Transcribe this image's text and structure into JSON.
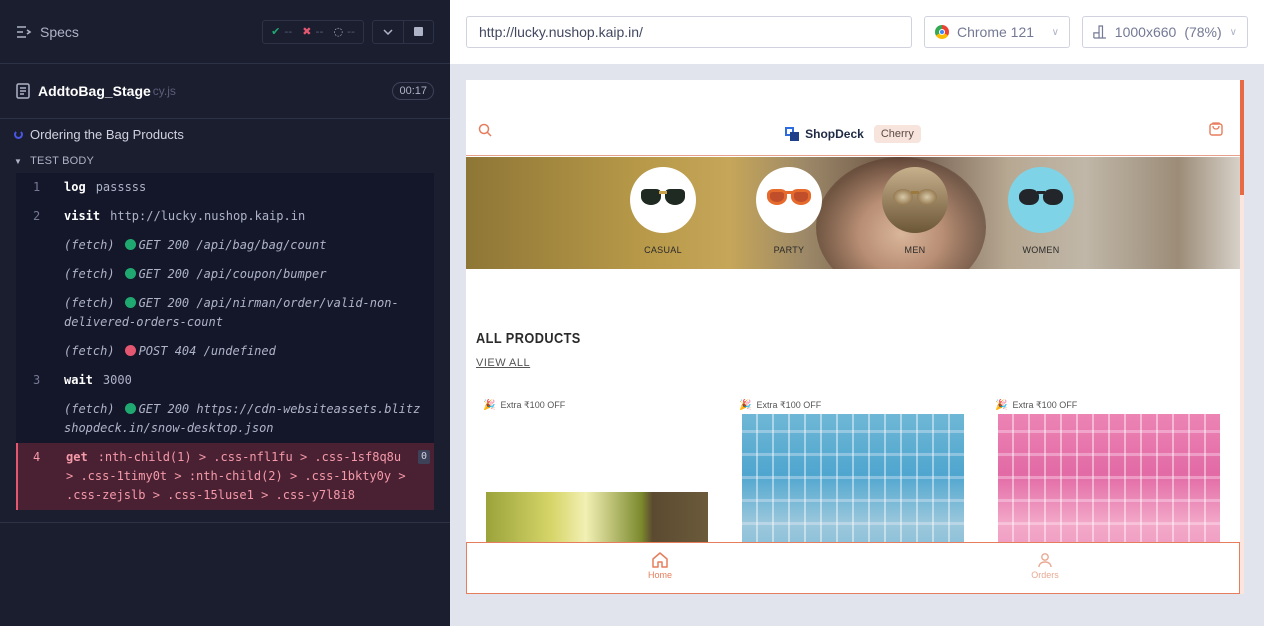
{
  "runner": {
    "specs_label": "Specs",
    "stats": {
      "passed": "--",
      "failed": "--",
      "pending": "--"
    },
    "spec": {
      "name": "AddtoBag_Stage",
      "ext": "cy.js",
      "duration": "00:17"
    },
    "suite": "Ordering the Bag Products",
    "test_body": "TEST BODY",
    "commands": [
      {
        "num": "1",
        "name": "log",
        "msg": "passsss"
      },
      {
        "num": "2",
        "name": "visit",
        "msg": "http://lucky.nushop.kaip.in"
      },
      {
        "name": "(fetch)",
        "status": "green",
        "msg": "GET 200 /api/bag/bag/count"
      },
      {
        "name": "(fetch)",
        "status": "green",
        "msg": "GET 200 /api/coupon/bumper"
      },
      {
        "name": "(fetch)",
        "status": "green",
        "msg": "GET 200 /api/nirman/order/valid-non-delivered-orders-count"
      },
      {
        "name": "(fetch)",
        "status": "red",
        "msg": "POST 404 /undefined"
      },
      {
        "num": "3",
        "name": "wait",
        "msg": "3000"
      },
      {
        "name": "(fetch)",
        "status": "green",
        "msg": "GET 200 https://cdn-websiteassets.blitzshopdeck.in/snow-desktop.json"
      },
      {
        "num": "4",
        "name": "get",
        "msg": ":nth-child(1) > .css-nfl1fu > .css-1sf8q8u > .css-1timy0t > :nth-child(2) > .css-1bkty0y > .css-zejslb > .css-15luse1 > .css-y7l8i8",
        "badge": "0"
      }
    ]
  },
  "preview": {
    "url": "http://lucky.nushop.kaip.in/",
    "browser": "Chrome 121",
    "viewport": "1000x660",
    "zoom": "(78%)"
  },
  "site": {
    "logo": "ShopDeck",
    "store_tag": "Cherry",
    "categories": [
      "CASUAL",
      "PARTY",
      "MEN",
      "WOMEN"
    ],
    "section_title": "ALL PRODUCTS",
    "view_all": "VIEW ALL",
    "offer": "Extra ₹100 OFF",
    "nav": {
      "home": "Home",
      "orders": "Orders"
    }
  },
  "colors": {
    "accent": "#e67d5c",
    "runner_bg": "#1b1e2e",
    "fail": "#e45770",
    "pass": "#1fa971"
  }
}
